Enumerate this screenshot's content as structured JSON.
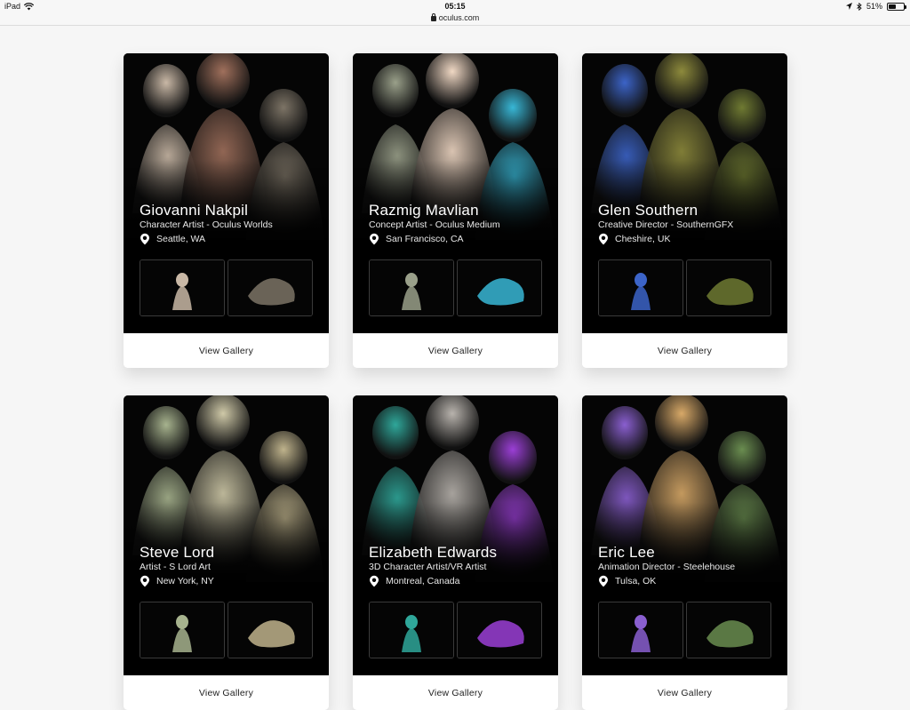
{
  "status_bar": {
    "device": "iPad",
    "time": "05:15",
    "battery": "51%",
    "battery_level": 0.51,
    "url": "oculus.com"
  },
  "cards": [
    {
      "name": "Giovanni Nakpil",
      "role": "Character Artist - Oculus Worlds",
      "location": "Seattle, WA",
      "button": "View Gallery",
      "palette": [
        "#c9b8a6",
        "#a0705c",
        "#7d7466"
      ]
    },
    {
      "name": "Razmig Mavlian",
      "role": "Concept Artist - Oculus Medium",
      "location": "San Francisco, CA",
      "button": "View Gallery",
      "palette": [
        "#9aa08a",
        "#f0d8c4",
        "#38b7d6"
      ]
    },
    {
      "name": "Glen Southern",
      "role": "Creative Director - SouthernGFX",
      "location": "Cheshire, UK",
      "button": "View Gallery",
      "palette": [
        "#3c64c8",
        "#8d8a3c",
        "#6f7a32"
      ]
    },
    {
      "name": "Steve Lord",
      "role": "Artist - S Lord Art",
      "location": "New York, NY",
      "button": "View Gallery",
      "palette": [
        "#a7b38e",
        "#cfc9a8",
        "#bfb38c"
      ]
    },
    {
      "name": "Elizabeth Edwards",
      "role": "3D Character Artist/VR Artist",
      "location": "Montreal, Canada",
      "button": "View Gallery",
      "palette": [
        "#2fa79a",
        "#b8b3ad",
        "#9b3fd6"
      ]
    },
    {
      "name": "Eric Lee",
      "role": "Animation Director - Steelehouse",
      "location": "Tulsa, OK",
      "button": "View Gallery",
      "palette": [
        "#8a5fd0",
        "#d8a968",
        "#6a8d50"
      ]
    }
  ]
}
